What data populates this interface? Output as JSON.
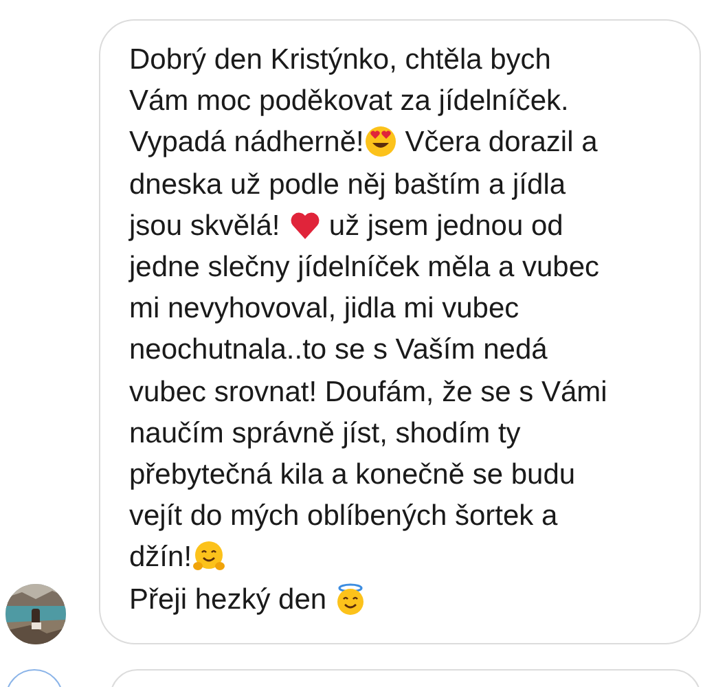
{
  "message": {
    "lines": [
      {
        "parts": [
          {
            "kind": "text",
            "text": "Dobrý den Kristýnko, chtěla bych"
          }
        ]
      },
      {
        "parts": [
          {
            "kind": "text",
            "text": "Vám moc poděkovat za jídelníček."
          }
        ]
      },
      {
        "parts": [
          {
            "kind": "text",
            "text": "Vypadá nádherně!"
          },
          {
            "kind": "heart_eyes"
          },
          {
            "kind": "text",
            "text": " Včera dorazil a"
          }
        ]
      },
      {
        "parts": [
          {
            "kind": "text",
            "text": "dneska už podle něj baštím a jídla"
          }
        ]
      },
      {
        "parts": [
          {
            "kind": "text",
            "text": "jsou skvělá! "
          },
          {
            "kind": "heart"
          },
          {
            "kind": "text",
            "text": " už jsem jednou od"
          }
        ]
      },
      {
        "parts": [
          {
            "kind": "text",
            "text": "jedne slečny jídelníček měla a vubec"
          }
        ]
      },
      {
        "parts": [
          {
            "kind": "text",
            "text": "mi nevyhovoval, jidla mi vubec"
          }
        ]
      },
      {
        "parts": [
          {
            "kind": "text",
            "text": "neochutnala..to se s Vaším nedá"
          }
        ]
      },
      {
        "parts": [
          {
            "kind": "text",
            "text": "vubec srovnat! Doufám, že se s Vámi"
          }
        ]
      },
      {
        "parts": [
          {
            "kind": "text",
            "text": "naučím správně jíst, shodím ty"
          }
        ]
      },
      {
        "parts": [
          {
            "kind": "text",
            "text": "přebytečná kila a konečně se budu"
          }
        ]
      },
      {
        "parts": [
          {
            "kind": "text",
            "text": "vejít do mých oblíbených šortek a"
          }
        ]
      },
      {
        "parts": [
          {
            "kind": "text",
            "text": "džín!"
          },
          {
            "kind": "hug"
          }
        ]
      },
      {
        "parts": [
          {
            "kind": "text",
            "text": "Přeji hezký den "
          },
          {
            "kind": "halo"
          }
        ]
      }
    ]
  }
}
